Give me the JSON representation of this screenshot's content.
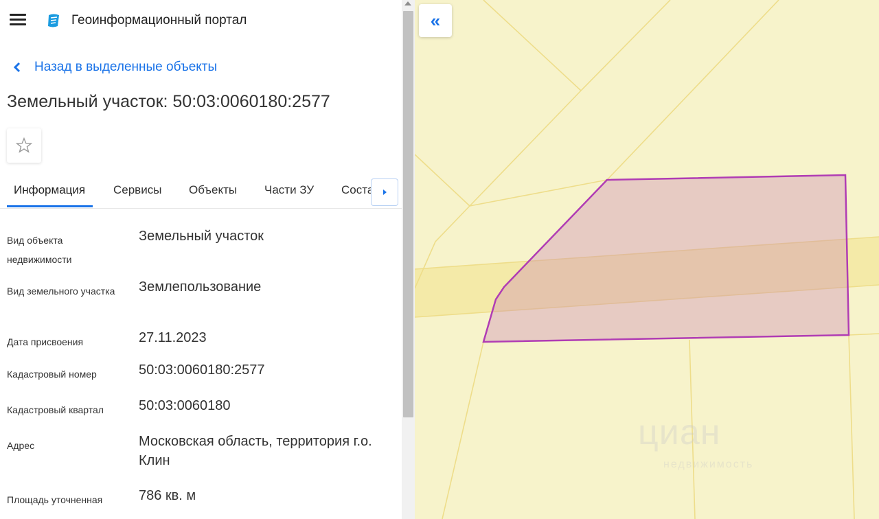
{
  "header": {
    "portal_title": "Геоинформационный портал"
  },
  "navigation": {
    "back_label": "Назад в выделенные объекты"
  },
  "object": {
    "title": "Земельный участок: 50:03:0060180:2577"
  },
  "tabs": [
    {
      "label": "Информация",
      "active": true
    },
    {
      "label": "Сервисы",
      "active": false
    },
    {
      "label": "Объекты",
      "active": false
    },
    {
      "label": "Части ЗУ",
      "active": false
    },
    {
      "label": "Состав",
      "active": false
    }
  ],
  "info": [
    {
      "label": "Вид объекта недвижимости",
      "value": "Земельный участок"
    },
    {
      "label": "Вид земельного участка",
      "value": "Землепользование"
    },
    {
      "label": "Дата присвоения",
      "value": "27.11.2023"
    },
    {
      "label": "Кадастровый номер",
      "value": "50:03:0060180:2577"
    },
    {
      "label": "Кадастровый квартал",
      "value": "50:03:0060180"
    },
    {
      "label": "Адрес",
      "value": "Московская область, территория г.о. Клин"
    },
    {
      "label": "Площадь уточненная",
      "value": "786 кв. м"
    }
  ],
  "map": {
    "collapse_label": "«",
    "watermark": "циан",
    "watermark_sub": "недвижимость"
  },
  "colors": {
    "accent": "#1a73e8",
    "map_background": "#f7f3cb",
    "parcel_fill": "#dcb4c8",
    "parcel_stroke": "#b03cb4"
  },
  "icons": {
    "menu": "hamburger-icon",
    "logo": "portal-logo-icon",
    "back": "chevron-left-icon",
    "favorite": "star-icon",
    "tab_next": "arrow-right-icon"
  }
}
